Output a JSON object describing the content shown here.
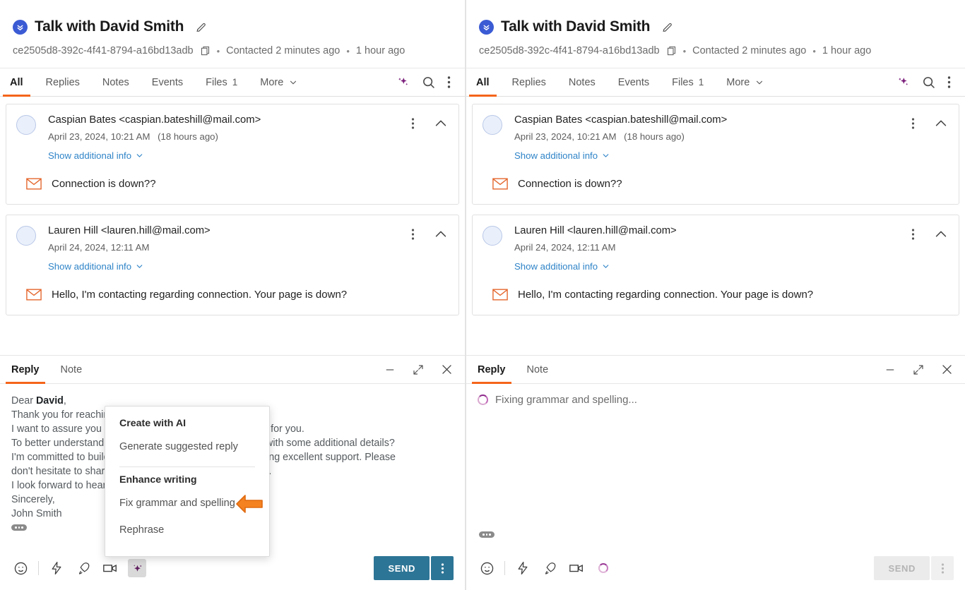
{
  "header": {
    "channel_badge_icon": "double-chevron-down-icon",
    "title": "Talk with David Smith",
    "edit_icon": "pencil-icon",
    "conversation_id": "ce2505d8-392c-4f41-8794-a16bd13adb",
    "copy_icon": "copy-icon",
    "dot": "•",
    "contacted": "Contacted 2 minutes ago",
    "updated": "1 hour ago"
  },
  "tabs": {
    "items": [
      {
        "label": "All",
        "count": "",
        "active": true
      },
      {
        "label": "Replies",
        "count": "",
        "active": false
      },
      {
        "label": "Notes",
        "count": "",
        "active": false
      },
      {
        "label": "Events",
        "count": "",
        "active": false
      },
      {
        "label": "Files",
        "count": "1",
        "active": false
      },
      {
        "label": "More",
        "count": "",
        "active": false,
        "chevron": "chevron-down-icon"
      }
    ],
    "actions": [
      {
        "icon": "ai-sparkles-icon"
      },
      {
        "icon": "search-icon"
      },
      {
        "icon": "kebab-menu-icon"
      }
    ]
  },
  "messages": [
    {
      "avatar": "avatar",
      "from": "Caspian Bates <caspian.bateshill@mail.com>",
      "date": "April 23, 2024, 10:21 AM",
      "relative": "(18 hours ago)",
      "show_info_label": "Show additional info",
      "channel_icon": "email-icon",
      "text": "Connection is down??",
      "kebab_icon": "kebab-menu-icon",
      "collapse_icon": "chevron-up-icon"
    },
    {
      "avatar": "avatar",
      "from": "Lauren Hill <lauren.hill@mail.com>",
      "date": "April 24, 2024, 12:11 AM",
      "relative": "",
      "show_info_label": "Show additional info",
      "channel_icon": "email-icon",
      "text": "Hello, I'm contacting regarding connection. Your page is down?",
      "kebab_icon": "kebab-menu-icon",
      "collapse_icon": "chevron-up-icon"
    }
  ],
  "composer": {
    "tabs": [
      {
        "label": "Reply",
        "active": true
      },
      {
        "label": "Note",
        "active": false
      }
    ],
    "window_actions": [
      {
        "icon": "minimize-icon"
      },
      {
        "icon": "expand-icon"
      },
      {
        "icon": "close-icon"
      }
    ],
    "draft_lines": [
      {
        "prefix": "Dear ",
        "bold": "David",
        "suffix": ","
      },
      {
        "prefix": "Thank you for reaching out and sharing your concerns.",
        "bold": "",
        "suffix": ""
      },
      {
        "prefix": "I want to assure you that we will find a solution that works for you.",
        "bold": "",
        "suffix": ""
      },
      {
        "prefix": "To better understand the situation, could you provide me with some additional details?",
        "bold": "",
        "suffix": ""
      },
      {
        "prefix": "I'm committed to building a strong relationship and providing excellent support. Please",
        "bold": "",
        "suffix": ""
      },
      {
        "prefix": "don't hesitate to share any further thoughts you may have.",
        "bold": "",
        "suffix": ""
      },
      {
        "prefix": "I look forward to hearing from you.",
        "bold": "",
        "suffix": ""
      },
      {
        "prefix": "Sincerely,",
        "bold": "",
        "suffix": ""
      },
      {
        "prefix": "John Smith",
        "bold": "",
        "suffix": ""
      }
    ],
    "signature_icon": "signature-block-icon",
    "toolbar": {
      "emoji_icon": "emoji-icon",
      "shortcut_icon": "lightning-icon",
      "macro_icon": "rocket-icon",
      "video_icon": "video-camera-icon",
      "ai_icon": "ai-sparkles-icon"
    },
    "send_label": "SEND",
    "send_kebab_icon": "kebab-menu-icon"
  },
  "ai_menu": {
    "groups": [
      {
        "label": "Create with AI",
        "items": [
          {
            "label": "Generate suggested reply"
          }
        ]
      },
      {
        "label": "Enhance writing",
        "items": [
          {
            "label": "Fix grammar and spelling"
          },
          {
            "label": "Rephrase"
          }
        ]
      }
    ],
    "cursor_icon": "left-arrow-cursor-icon"
  },
  "right_composer": {
    "loading_text": "Fixing grammar and spelling...",
    "loading_icon": "spinner-icon",
    "signature_icon": "signature-block-icon",
    "send_label": "SEND",
    "send_disabled": true
  },
  "colors": {
    "accent_orange": "#f4651a",
    "send_teal": "#2d7596",
    "ai_purple": "#7b1f7b",
    "link_blue": "#2f84c8",
    "badge_blue": "#3b5bd4"
  }
}
